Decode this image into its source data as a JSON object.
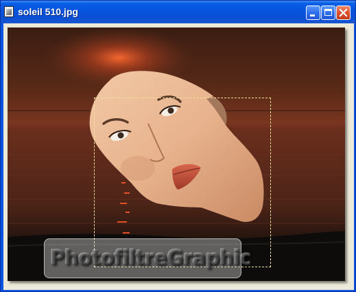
{
  "window": {
    "title": "soleil 510.jpg",
    "icon": "photofiltre-document-icon",
    "controls": [
      "minimize-icon",
      "maximize-icon",
      "close-icon"
    ]
  },
  "image": {
    "description_icons": [
      "sunset-sea-scene",
      "face-cutout-layer"
    ],
    "watermark": "PhotofiltreGraphic"
  },
  "colors": {
    "titlebar": "#0a54e0",
    "client_bg": "#ece9d8",
    "selection": "#f4e3a0",
    "close_button": "#dd4f2c"
  }
}
